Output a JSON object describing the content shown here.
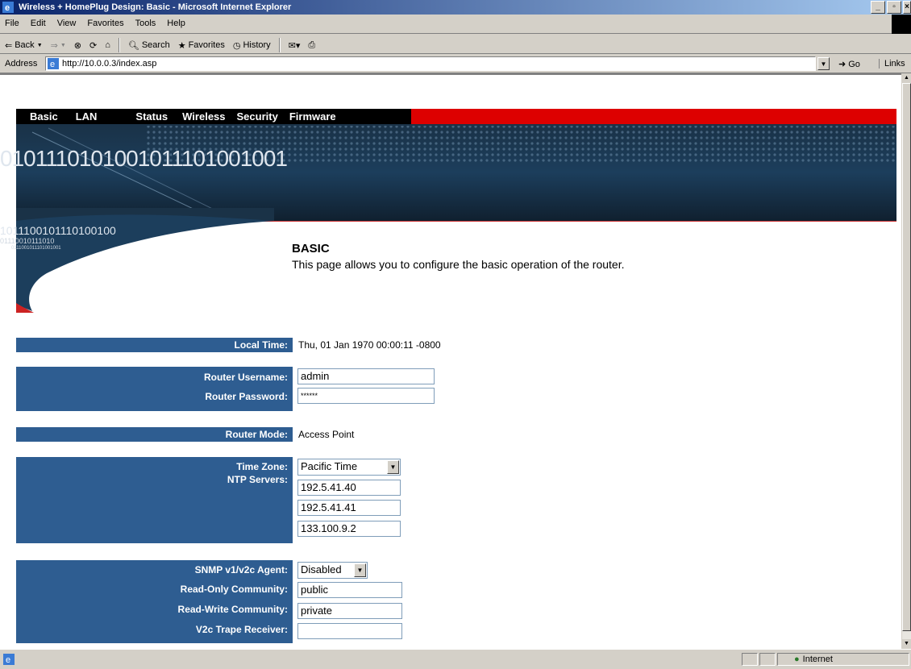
{
  "window": {
    "title": "Wireless + HomePlug Design: Basic - Microsoft Internet Explorer",
    "buttons": [
      "_",
      "Ā",
      "×"
    ]
  },
  "menu": [
    "File",
    "Edit",
    "View",
    "Favorites",
    "Tools",
    "Help"
  ],
  "toolbar": {
    "back": "Back",
    "search": "Search",
    "favorites": "Favorites",
    "history": "History"
  },
  "address": {
    "label": "Address",
    "url": "http://10.0.0.3/index.asp",
    "go": "Go",
    "links": "Links"
  },
  "nav": [
    "Basic",
    "LAN",
    "Status",
    "Wireless",
    "Security",
    "Firmware"
  ],
  "banner": {
    "binary_large": "0101110101001011101001001",
    "binary_medium": "1011100101110100100",
    "binary_small": "01110010111010",
    "binary_tiny": "0111001011101001001"
  },
  "page": {
    "title": "BASIC",
    "description": "This page allows you to configure the basic operation of the router."
  },
  "form": {
    "local_time_label": "Local Time:",
    "local_time": "Thu, 01 Jan 1970 00:00:11 -0800",
    "username_label": "Router Username:",
    "username": "admin",
    "password_label": "Router Password:",
    "password": "******",
    "mode_label": "Router Mode:",
    "mode": "Access Point",
    "timezone_label": "Time Zone:",
    "timezone": "Pacific Time",
    "ntp_label": "NTP Servers:",
    "ntp_servers": [
      "192.5.41.40",
      "192.5.41.41",
      "133.100.9.2"
    ],
    "snmp_label": "SNMP v1/v2c Agent:",
    "snmp": "Disabled",
    "ro_label": "Read-Only Community:",
    "ro": "public",
    "rw_label": "Read-Write Community:",
    "rw": "private",
    "trap_label": "V2c Trape Receiver:",
    "trap": ""
  },
  "status": {
    "zone": "Internet"
  }
}
